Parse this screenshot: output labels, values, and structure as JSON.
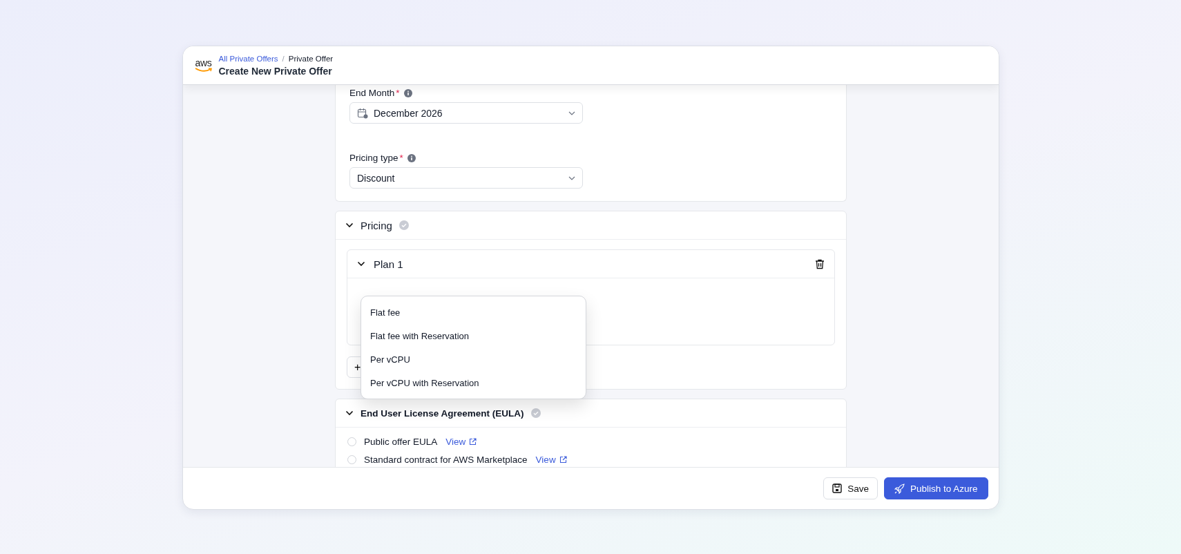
{
  "header": {
    "breadcrumbs": [
      {
        "label": "All Private Offers",
        "link": true
      },
      {
        "label": "Private Offer",
        "link": false
      }
    ],
    "breadcrumb_separator": "/",
    "title": "Create New Private Offer",
    "logo_text": "aws"
  },
  "offer_card": {
    "fields": [
      {
        "label": "End Month",
        "required_mark": "*",
        "value": "December 2026",
        "kind": "month"
      },
      {
        "label": "Pricing type",
        "required_mark": "*",
        "value": "Discount",
        "kind": "select"
      }
    ]
  },
  "pricing": {
    "title": "Pricing",
    "expanded": true,
    "plans": [
      {
        "title": "Plan 1",
        "expanded": true
      }
    ],
    "add_button": {
      "label": "+"
    },
    "dropdown": {
      "options": [
        {
          "label": "Flat fee"
        },
        {
          "label": "Flat fee with Reservation"
        },
        {
          "label": "Per vCPU"
        },
        {
          "label": "Per vCPU with Reservation"
        }
      ]
    }
  },
  "eula": {
    "title": "End User License Agreement (EULA)",
    "expanded": true,
    "options": [
      {
        "label": "Public offer EULA",
        "link": "View",
        "selected": false
      },
      {
        "label": "Standard contract for AWS Marketplace",
        "link": "View",
        "selected": false
      }
    ]
  },
  "footer": {
    "buttons": [
      {
        "label": "Save",
        "kind": "secondary"
      },
      {
        "label": "Publish to Azure",
        "kind": "primary"
      }
    ]
  }
}
